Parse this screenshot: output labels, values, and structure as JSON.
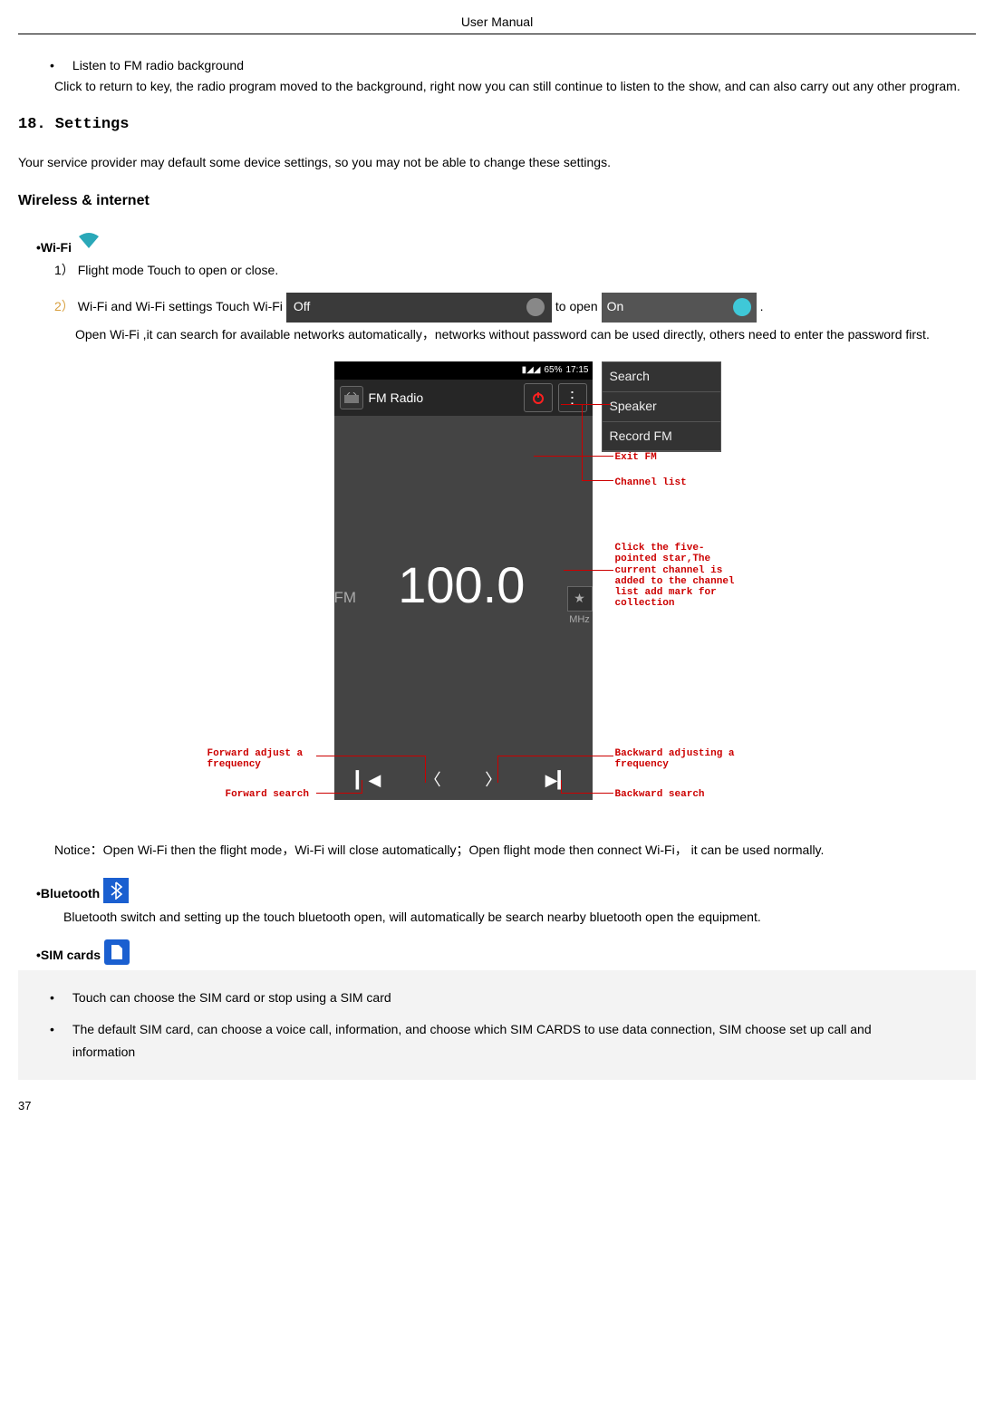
{
  "header": {
    "title": "User  Manual"
  },
  "fm": {
    "bullet_label": "Listen to FM radio background",
    "bullet_desc": "Click to return to key, the radio program moved to the background, right now you can still continue to listen to the show, and can also carry out any other program."
  },
  "settings": {
    "heading": "18. Settings",
    "intro": "Your service provider may default some device settings, so you may not be able to change these settings.",
    "wireless_heading": "Wireless & internet",
    "wifi_label": "•Wi-Fi",
    "item1_num": "1）",
    "item1_text": "Flight mode    Touch to open or close.",
    "item2_num": "2）",
    "item2_pre": "Wi-Fi and Wi-Fi settings     Touch Wi-Fi",
    "item2_off": "Off",
    "item2_mid": "to open",
    "item2_on": "On",
    "item2_end": ".",
    "item2_body": "Open Wi-Fi ,it can search for available networks automatically，networks without password can be used directly, others need to enter the password first.",
    "notice": "Notice：Open Wi-Fi then the flight mode，Wi-Fi will close automatically；Open flight mode then connect Wi-Fi， it can be used normally.",
    "bt_label": "•Bluetooth",
    "bt_body": "Bluetooth switch and setting up the touch bluetooth open, will automatically be search nearby bluetooth open the equipment.",
    "sim_label": "•SIM cards",
    "sim_b1": "Touch can choose the SIM card or stop using a SIM card",
    "sim_b2": "The default SIM card, can choose a voice call, information, and choose which SIM CARDS to use data connection, SIM choose set up call and information"
  },
  "diagram": {
    "status": {
      "batt": "65%",
      "time": "17:15"
    },
    "app_title": "FM Radio",
    "fm_lbl": "FM",
    "freq": "100.0",
    "mhz": "MHz",
    "menu_items": [
      "Search",
      "Speaker",
      "Record FM"
    ],
    "ann_exit": "Exit FM",
    "ann_chlist": "Channel list",
    "ann_star": "Click the five-pointed star,The current channel is added to the channel list add mark for collection",
    "ann_fwd_adj": "Forward adjust a frequency",
    "ann_fwd_search": "Forward search",
    "ann_bwd_adj": "Backward adjusting a frequency",
    "ann_bwd_search": "Backward search"
  },
  "footer": {
    "page": "37"
  }
}
